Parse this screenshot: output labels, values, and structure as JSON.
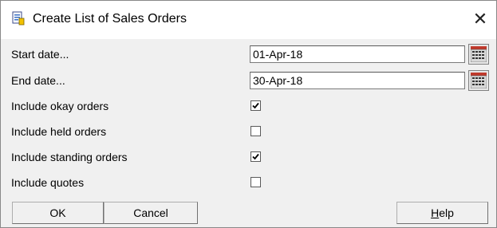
{
  "window": {
    "title": "Create List of Sales Orders",
    "title_icon": "report-icon",
    "close_glyph": "✕"
  },
  "fields": {
    "start_date": {
      "label": "Start date...",
      "value": "01-Apr-18",
      "calendar_icon": "calendar-icon"
    },
    "end_date": {
      "label": "End date...",
      "value": "30-Apr-18",
      "calendar_icon": "calendar-icon"
    }
  },
  "options": [
    {
      "label": "Include okay orders",
      "checked": true
    },
    {
      "label": "Include held orders",
      "checked": false
    },
    {
      "label": "Include standing orders",
      "checked": true
    },
    {
      "label": "Include quotes",
      "checked": false
    }
  ],
  "buttons": {
    "ok": "OK",
    "cancel": "Cancel",
    "help_accel": "H",
    "help_rest": "elp"
  },
  "colors": {
    "title_bg": "#ffffff",
    "dialog_bg": "#f0f0f0",
    "calendar_red": "#c0392b"
  }
}
